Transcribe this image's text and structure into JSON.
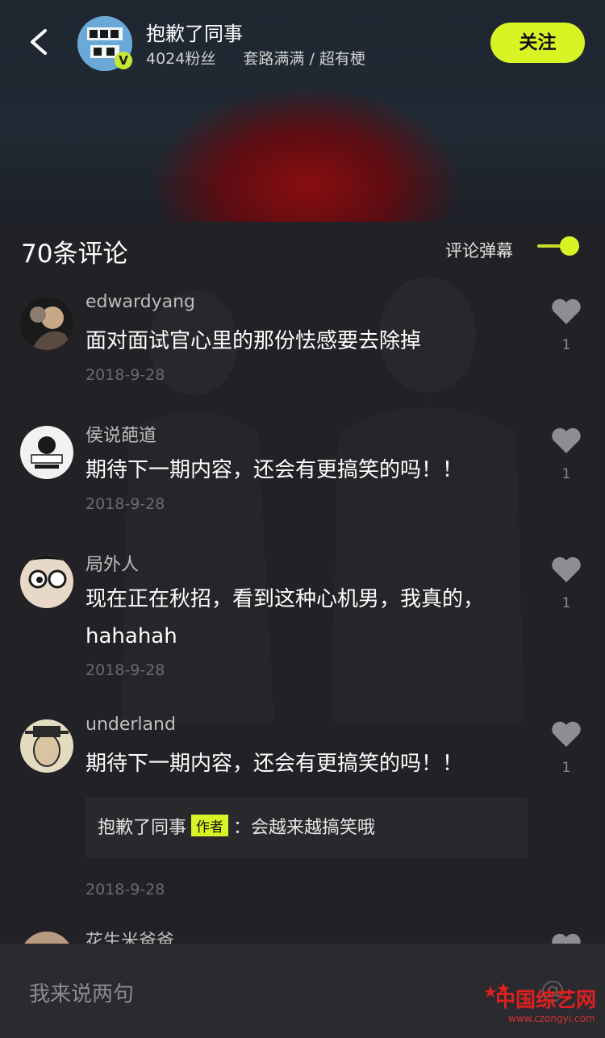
{
  "header": {
    "account_name": "抱歉了同事",
    "fans": "4024粉丝",
    "description": "套路满满 / 超有梗",
    "follow_label": "关注",
    "avatar_text": "抱歉了同事",
    "verified_mark": "V"
  },
  "comments_panel": {
    "count_label": "70条评论",
    "danmu_label": "评论弹幕",
    "danmu_enabled": true
  },
  "comments": [
    {
      "user": "edwardyang",
      "text": "面对面试官心里的那份怯感要去除掉",
      "date": "2018-9-28",
      "likes": "1"
    },
    {
      "user": "侯说葩道",
      "text": "期待下一期内容，还会有更搞笑的吗！！",
      "date": "2018-9-28",
      "likes": "1"
    },
    {
      "user": "局外人",
      "text": "现在正在秋招，看到这种心机男，我真的，hahahah",
      "date": "2018-9-28",
      "likes": "1"
    },
    {
      "user": "underland",
      "text": "期待下一期内容，还会有更搞笑的吗！！",
      "date": "2018-9-28",
      "likes": "1",
      "reply": {
        "author": "抱歉了同事",
        "badge": "作者",
        "text": "会越来越搞笑哦"
      }
    },
    {
      "user": "花生米爸爸"
    }
  ],
  "input": {
    "placeholder": "我来说两句",
    "at_symbol": "@"
  },
  "watermark": {
    "text": "中国综艺网",
    "url": "www.czongyi.com"
  },
  "colors": {
    "accent": "#d9f425",
    "background": "#222226",
    "input_bar": "#2b2b2f"
  }
}
